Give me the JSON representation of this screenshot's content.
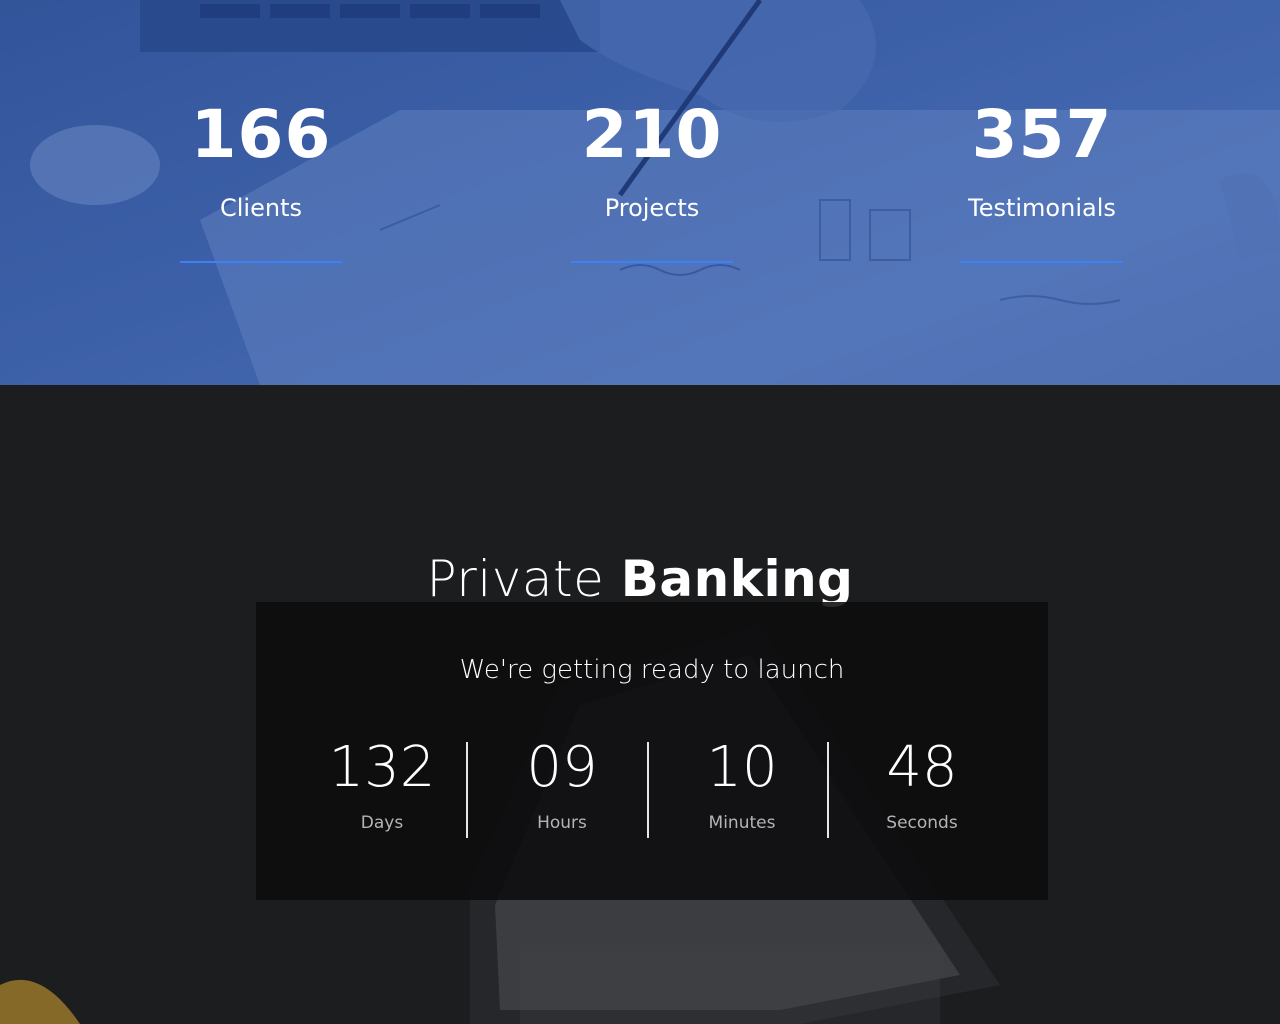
{
  "stats": [
    {
      "value": "166",
      "label": "Clients"
    },
    {
      "value": "210",
      "label": "Projects"
    },
    {
      "value": "357",
      "label": "Testimonials"
    }
  ],
  "launch": {
    "title_light": "Private",
    "title_bold": "Banking",
    "subtitle": "We're getting ready to launch",
    "countdown": [
      {
        "value": "132",
        "unit": "Days"
      },
      {
        "value": "09",
        "unit": "Hours"
      },
      {
        "value": "10",
        "unit": "Minutes"
      },
      {
        "value": "48",
        "unit": "Seconds"
      }
    ]
  },
  "colors": {
    "accent": "#3b82f6",
    "stats_overlay": "#3a5d9c",
    "dark_bg": "#1c1d1f",
    "panel_bg": "#0c0d0e"
  }
}
